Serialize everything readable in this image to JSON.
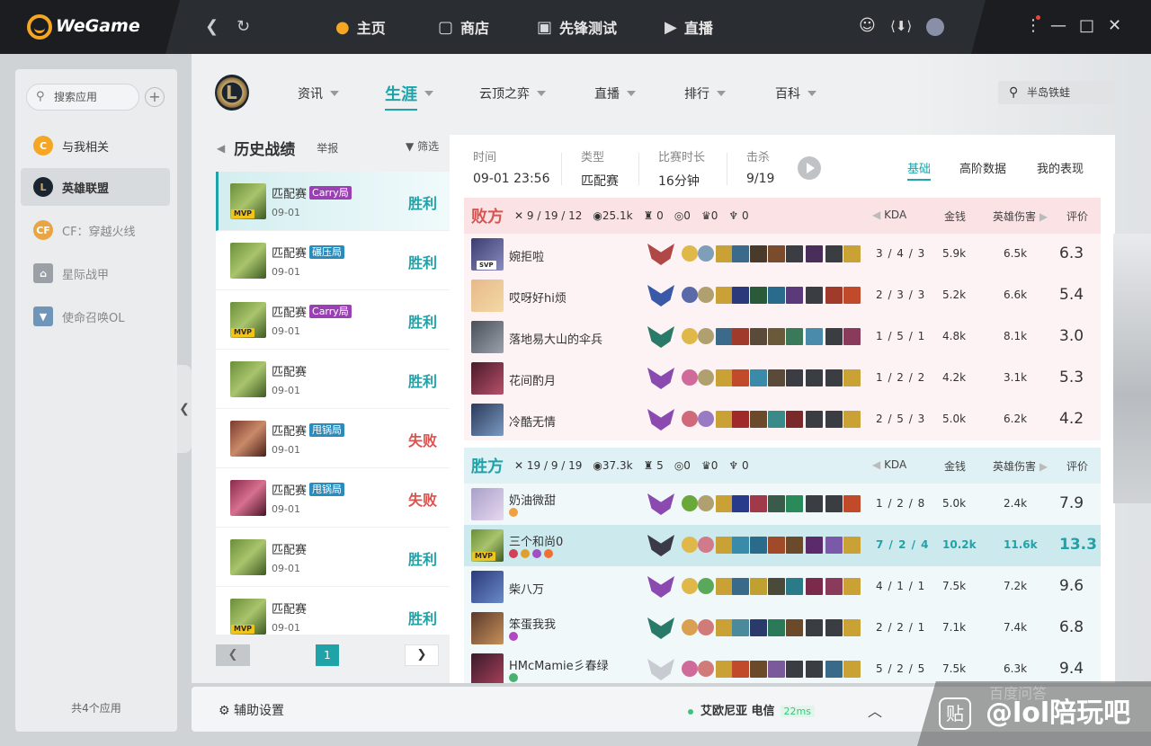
{
  "app": {
    "title": "WeGame"
  },
  "topnav": [
    {
      "label": "主页",
      "icon": "home-icon"
    },
    {
      "label": "商店",
      "icon": "store-icon"
    },
    {
      "label": "先锋测试",
      "icon": "test-icon"
    },
    {
      "label": "直播",
      "icon": "live-icon"
    }
  ],
  "sidebar": {
    "search_placeholder": "搜索应用",
    "items": [
      {
        "label": "与我相关"
      },
      {
        "label": "英雄联盟"
      },
      {
        "label": "CF：穿越火线"
      },
      {
        "label": "星际战甲"
      },
      {
        "label": "使命召唤OL"
      }
    ],
    "footer": "共4个应用"
  },
  "subnav": [
    {
      "label": "资讯"
    },
    {
      "label": "生涯"
    },
    {
      "label": "云顶之弈"
    },
    {
      "label": "直播"
    },
    {
      "label": "排行"
    },
    {
      "label": "百科"
    }
  ],
  "summoner_search": "半岛铁蛙",
  "history": {
    "title": "历史战绩",
    "report": "举报",
    "filter": "筛选",
    "matches": [
      {
        "mode": "匹配赛",
        "tag": "Carry局",
        "tag_color": "#9b3fb5",
        "date": "09-01",
        "result": "胜利",
        "mvp": "MVP"
      },
      {
        "mode": "匹配赛",
        "tag": "碾压局",
        "tag_color": "#2a8bbd",
        "date": "09-01",
        "result": "胜利",
        "mvp": ""
      },
      {
        "mode": "匹配赛",
        "tag": "Carry局",
        "tag_color": "#9b3fb5",
        "date": "09-01",
        "result": "胜利",
        "mvp": "MVP"
      },
      {
        "mode": "匹配赛",
        "tag": "",
        "tag_color": "",
        "date": "09-01",
        "result": "胜利",
        "mvp": ""
      },
      {
        "mode": "匹配赛",
        "tag": "甩锅局",
        "tag_color": "#2a8bbd",
        "date": "09-01",
        "result": "失败",
        "mvp": ""
      },
      {
        "mode": "匹配赛",
        "tag": "甩锅局",
        "tag_color": "#2a8bbd",
        "date": "09-01",
        "result": "失败",
        "mvp": ""
      },
      {
        "mode": "匹配赛",
        "tag": "",
        "tag_color": "",
        "date": "09-01",
        "result": "胜利",
        "mvp": ""
      },
      {
        "mode": "匹配赛",
        "tag": "",
        "tag_color": "",
        "date": "09-01",
        "result": "胜利",
        "mvp": "MVP"
      }
    ],
    "page": "1"
  },
  "detail": {
    "time_label": "时间",
    "time": "09-01 23:56",
    "type_label": "类型",
    "type": "匹配赛",
    "duration_label": "比赛时长",
    "duration": "16分钟",
    "kills_label": "击杀",
    "kills": "9/19",
    "tabs": [
      "基础",
      "高阶数据",
      "我的表现"
    ],
    "cols": {
      "kda": "KDA",
      "gold": "金钱",
      "dmg": "英雄伤害",
      "score": "评价"
    }
  },
  "teams": [
    {
      "name": "败方",
      "kda": "9 / 19 / 12",
      "gold": "25.1k",
      "towers": "0",
      "inhib": "0",
      "baron": "0",
      "dragon": "0",
      "players": [
        {
          "name": "婉拒啦",
          "kda": "3 / 4 / 3",
          "gold": "5.9k",
          "dmg": "6.5k",
          "score": "6.3",
          "badge": "SVP"
        },
        {
          "name": "哎呀好hi烦",
          "kda": "2 / 3 / 3",
          "gold": "5.2k",
          "dmg": "6.6k",
          "score": "5.4",
          "badge": ""
        },
        {
          "name": "落地易大山的伞兵",
          "kda": "1 / 5 / 1",
          "gold": "4.8k",
          "dmg": "8.1k",
          "score": "3.0",
          "badge": ""
        },
        {
          "name": "花间酌月",
          "kda": "1 / 2 / 2",
          "gold": "4.2k",
          "dmg": "3.1k",
          "score": "5.3",
          "badge": ""
        },
        {
          "name": "冷酷无情",
          "kda": "2 / 5 / 3",
          "gold": "5.0k",
          "dmg": "6.2k",
          "score": "4.2",
          "badge": ""
        }
      ]
    },
    {
      "name": "胜方",
      "kda": "19 / 9 / 19",
      "gold": "37.3k",
      "towers": "5",
      "inhib": "0",
      "baron": "0",
      "dragon": "0",
      "players": [
        {
          "name": "奶油微甜",
          "kda": "1 / 2 / 8",
          "gold": "5.0k",
          "dmg": "2.4k",
          "score": "7.9",
          "badge": ""
        },
        {
          "name": "三个和尚0",
          "kda": "7 / 2 / 4",
          "gold": "10.2k",
          "dmg": "11.6k",
          "score": "13.3",
          "badge": "MVP"
        },
        {
          "name": "柴八万",
          "kda": "4 / 1 / 1",
          "gold": "7.5k",
          "dmg": "7.2k",
          "score": "9.6",
          "badge": ""
        },
        {
          "name": "笨蛋我我",
          "kda": "2 / 2 / 1",
          "gold": "7.1k",
          "dmg": "7.4k",
          "score": "6.8",
          "badge": ""
        },
        {
          "name": "HMcMamie彡春绿",
          "kda": "5 / 2 / 5",
          "gold": "7.5k",
          "dmg": "6.3k",
          "score": "9.4",
          "badge": ""
        }
      ]
    }
  ],
  "bottom": {
    "assist": "辅助设置",
    "server": "艾欧尼亚 电信",
    "ping": "22ms"
  },
  "watermark": {
    "text": "@lol陪玩吧",
    "ghost": "百度问答",
    "icon": "贴"
  }
}
